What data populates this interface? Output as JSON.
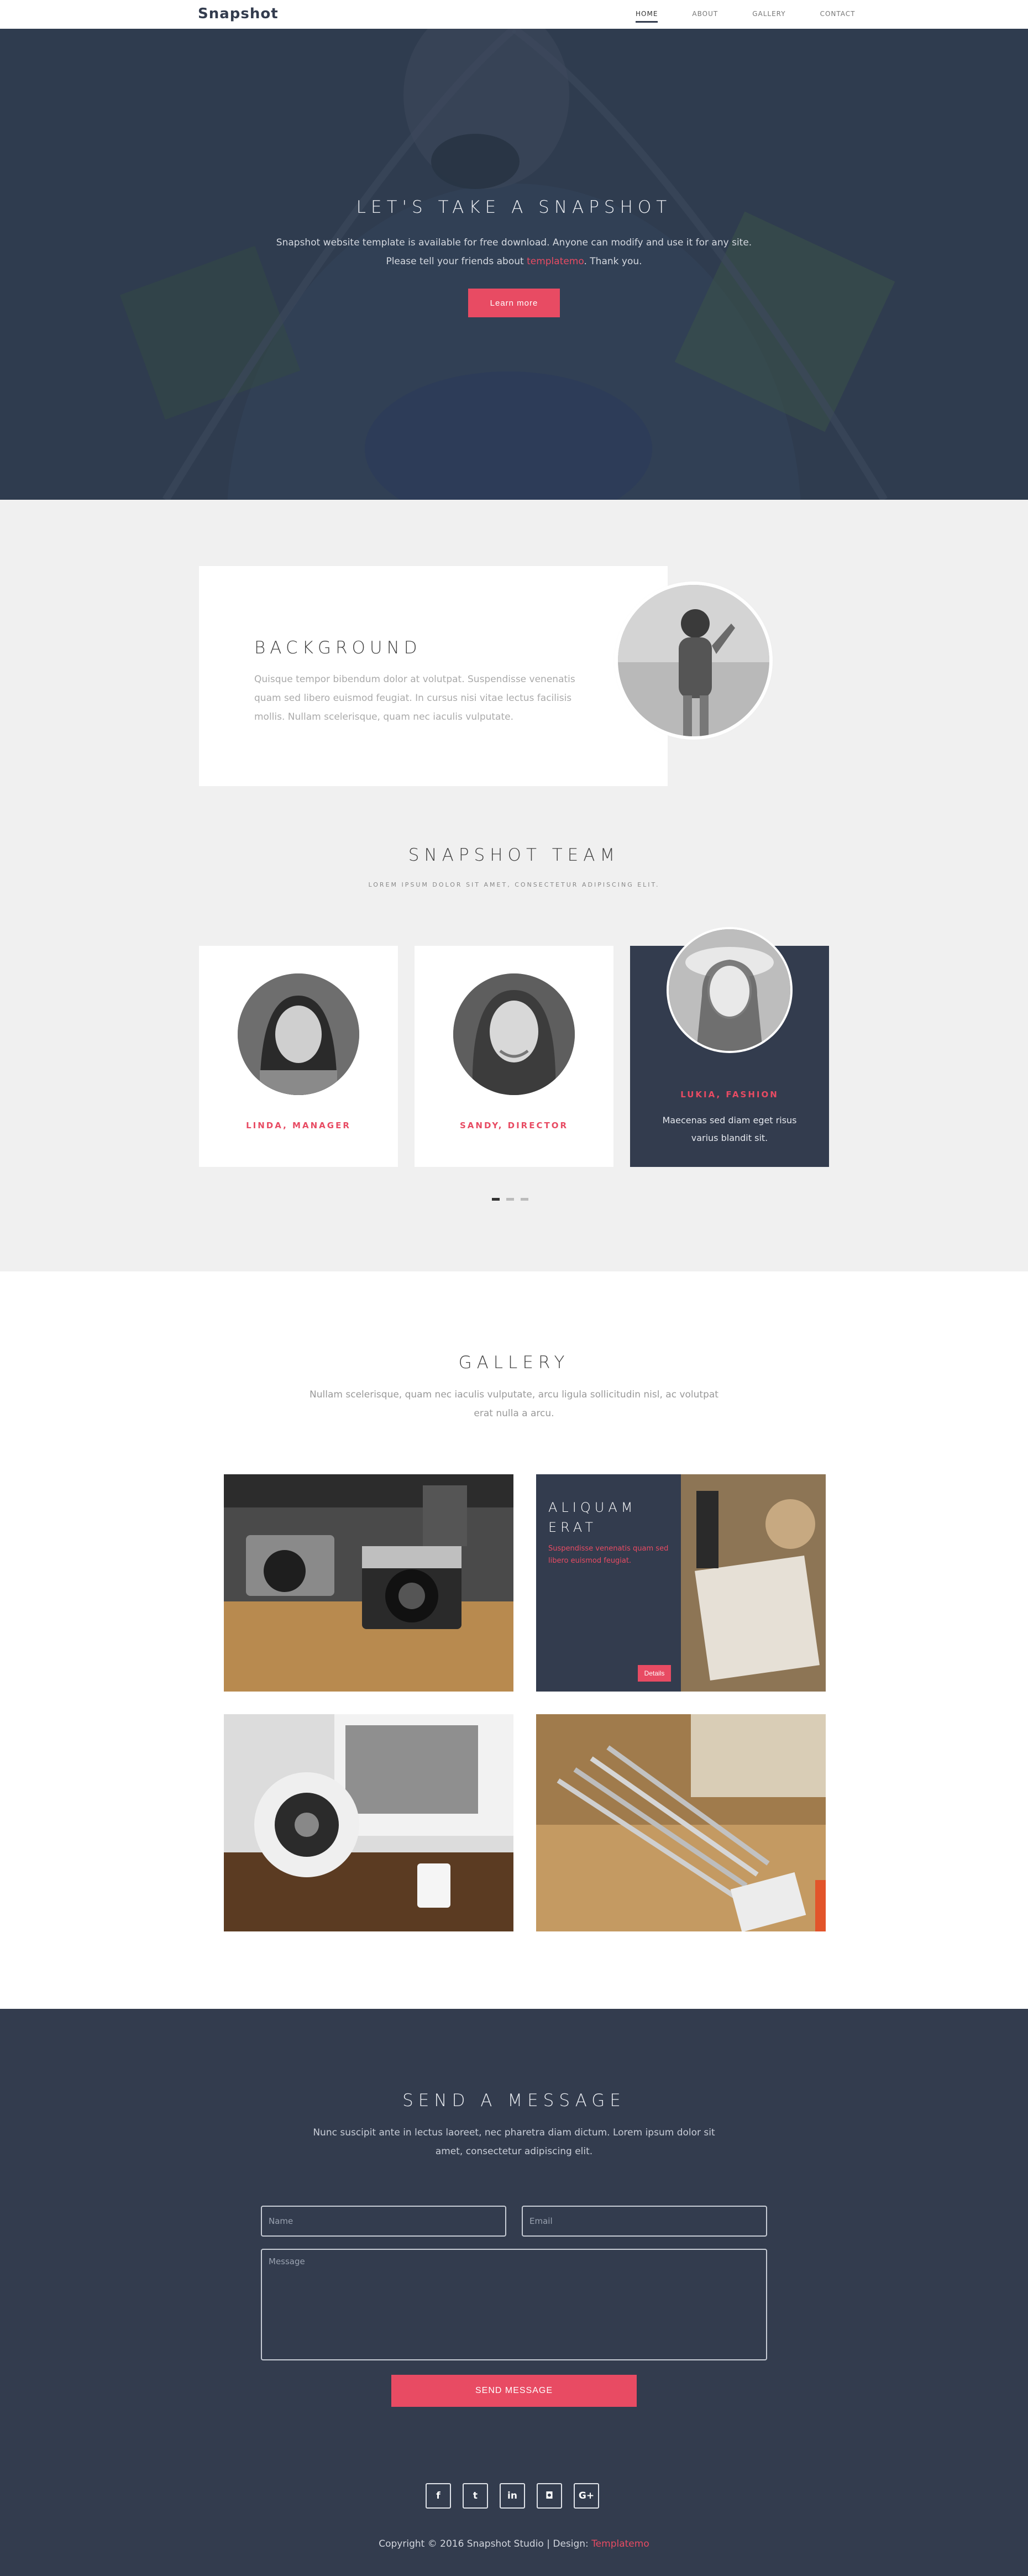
{
  "nav": {
    "brand": "Snapshot",
    "links": [
      {
        "label": "HOME",
        "active": true
      },
      {
        "label": "ABOUT",
        "active": false
      },
      {
        "label": "GALLERY",
        "active": false
      },
      {
        "label": "CONTACT",
        "active": false
      }
    ]
  },
  "hero": {
    "title": "LET'S TAKE A SNAPSHOT",
    "line1": "Snapshot website template is available for free download. Anyone can modify and use it for any site.",
    "line2_pre": "Please tell your friends about ",
    "line2_link": "templatemo",
    "line2_post": ". Thank you.",
    "button": "Learn more"
  },
  "background": {
    "title": "BACKGROUND",
    "text": "Quisque tempor bibendum dolor at volutpat. Suspendisse venenatis quam sed libero euismod feugiat. In cursus nisi vitae lectus facilisis mollis. Nullam scelerisque, quam nec iaculis vulputate."
  },
  "team": {
    "title": "SNAPSHOT TEAM",
    "subtitle": "LOREM IPSUM DOLOR SIT AMET, CONSECTETUR ADIPISCING ELIT.",
    "members": [
      {
        "name": "LINDA, MANAGER"
      },
      {
        "name": "SANDY, DIRECTOR"
      },
      {
        "name": "LUKIA, FASHION",
        "desc": "Maecenas sed diam eget risus varius blandit sit."
      }
    ]
  },
  "gallery": {
    "title": "GALLERY",
    "text": "Nullam scelerisque, quam nec iaculis vulputate, arcu ligula sollicitudin nisl, ac volutpat erat nulla a arcu.",
    "overlay_title": "ALIQUAM ERAT",
    "overlay_text": "Suspendisse venenatis quam sed libero euismod feugiat.",
    "overlay_button": "Details"
  },
  "contact": {
    "title": "SEND A MESSAGE",
    "text": "Nunc suscipit ante in lectus laoreet, nec pharetra diam dictum. Lorem ipsum dolor sit amet, consectetur adipiscing elit.",
    "name_placeholder": "Name",
    "email_placeholder": "Email",
    "message_placeholder": "Message",
    "button": "SEND MESSAGE"
  },
  "footer": {
    "socials": [
      {
        "icon": "facebook-icon",
        "glyph": "f"
      },
      {
        "icon": "twitter-icon",
        "glyph": "t"
      },
      {
        "icon": "linkedin-icon",
        "glyph": "in"
      },
      {
        "icon": "instagram-icon",
        "glyph": "◘"
      },
      {
        "icon": "google-plus-icon",
        "glyph": "G+"
      }
    ],
    "copyright_pre": "Copyright © 2016 Snapshot Studio | Design: ",
    "copyright_link": "Templatemo"
  },
  "colors": {
    "accent": "#e84b63",
    "dark": "#333c4e",
    "light": "#f0f0f0"
  }
}
